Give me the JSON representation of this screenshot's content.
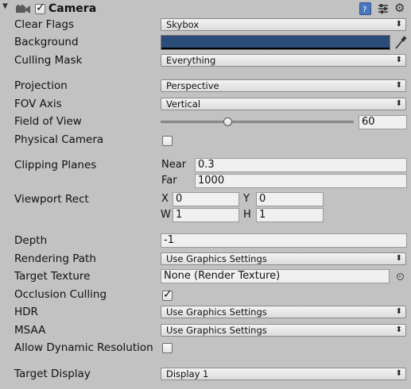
{
  "header": {
    "title": "Camera",
    "enabled": true
  },
  "colors": {
    "background_swatch": "#2b4b78"
  },
  "rows": {
    "clear_flags": {
      "label": "Clear Flags",
      "value": "Skybox"
    },
    "background": {
      "label": "Background"
    },
    "culling_mask": {
      "label": "Culling Mask",
      "value": "Everything"
    },
    "projection": {
      "label": "Projection",
      "value": "Perspective"
    },
    "fov_axis": {
      "label": "FOV Axis",
      "value": "Vertical"
    },
    "field_of_view": {
      "label": "Field of View",
      "value": "60",
      "fraction": 0.34
    },
    "physical_camera": {
      "label": "Physical Camera",
      "checked": false
    },
    "clipping_planes": {
      "label": "Clipping Planes",
      "near_label": "Near",
      "near": "0.3",
      "far_label": "Far",
      "far": "1000"
    },
    "viewport_rect": {
      "label": "Viewport Rect",
      "x_label": "X",
      "x": "0",
      "y_label": "Y",
      "y": "0",
      "w_label": "W",
      "w": "1",
      "h_label": "H",
      "h": "1"
    },
    "depth": {
      "label": "Depth",
      "value": "-1"
    },
    "rendering_path": {
      "label": "Rendering Path",
      "value": "Use Graphics Settings"
    },
    "target_texture": {
      "label": "Target Texture",
      "value": "None (Render Texture)"
    },
    "occlusion_culling": {
      "label": "Occlusion Culling",
      "checked": true
    },
    "hdr": {
      "label": "HDR",
      "value": "Use Graphics Settings"
    },
    "msaa": {
      "label": "MSAA",
      "value": "Use Graphics Settings"
    },
    "allow_dynamic_resolution": {
      "label": "Allow Dynamic Resolution",
      "checked": false
    },
    "target_display": {
      "label": "Target Display",
      "value": "Display 1"
    }
  }
}
